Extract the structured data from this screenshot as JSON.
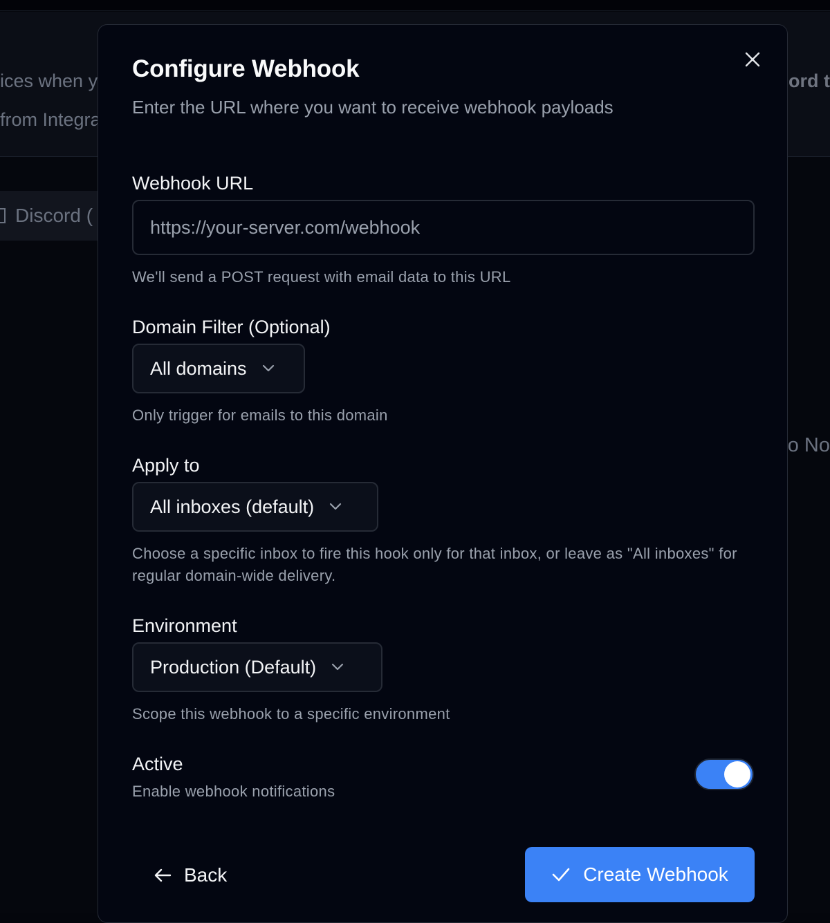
{
  "background": {
    "header_line1": "ices when y",
    "header_line2": "from Integra",
    "header_right": "cord t",
    "chip_label": "Discord (",
    "right_mid": "o No"
  },
  "modal": {
    "title": "Configure Webhook",
    "subtitle": "Enter the URL where you want to receive webhook payloads",
    "close_icon": "close-icon"
  },
  "webhook_url": {
    "label": "Webhook URL",
    "value": "",
    "placeholder": "https://your-server.com/webhook",
    "hint": "We'll send a POST request with email data to this URL"
  },
  "domain_filter": {
    "label": "Domain Filter (Optional)",
    "selected": "All domains",
    "hint": "Only trigger for emails to this domain"
  },
  "apply_to": {
    "label": "Apply to",
    "selected": "All inboxes (default)",
    "hint": "Choose a specific inbox to fire this hook only for that inbox, or leave as \"All inboxes\" for regular domain-wide delivery."
  },
  "environment": {
    "label": "Environment",
    "selected": "Production (Default)",
    "hint": "Scope this webhook to a specific environment"
  },
  "active": {
    "label": "Active",
    "hint": "Enable webhook notifications",
    "enabled": true
  },
  "footer": {
    "back_label": "Back",
    "create_label": "Create Webhook"
  },
  "colors": {
    "accent": "#3b82f6",
    "modal_bg": "#030611",
    "border": "#262b36",
    "muted_text": "#9aa1ad"
  }
}
